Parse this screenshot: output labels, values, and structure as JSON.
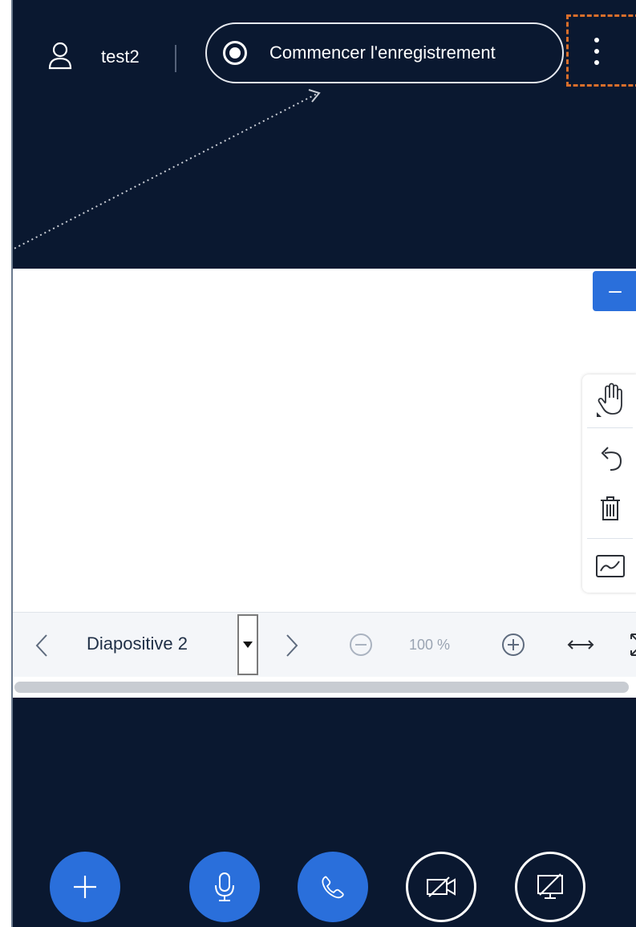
{
  "header": {
    "username": "test2",
    "record_label": "Commencer l'enregistrement"
  },
  "whiteboard": {
    "minimize_label": "–"
  },
  "slide_bar": {
    "slide_name": "Diapositive 2",
    "zoom_level": "100 %"
  },
  "colors": {
    "background": "#0a1830",
    "accent": "#2a6fdb",
    "highlight": "#d96f2b"
  },
  "icons": {
    "user": "user-icon",
    "record": "record-icon",
    "menu": "vertical-dots-icon",
    "hand": "hand-icon",
    "undo": "undo-icon",
    "trash": "trash-icon",
    "chart": "chart-icon",
    "prev": "chevron-left-icon",
    "next": "chevron-right-icon",
    "zoom_out": "zoom-out-icon",
    "zoom_in": "zoom-in-icon",
    "fit_width": "fit-width-icon",
    "fullscreen": "fullscreen-icon",
    "actions": "plus-icon",
    "mic": "microphone-icon",
    "phone": "phone-icon",
    "camera_off": "camera-off-icon",
    "screen_share_off": "screen-share-off-icon"
  }
}
